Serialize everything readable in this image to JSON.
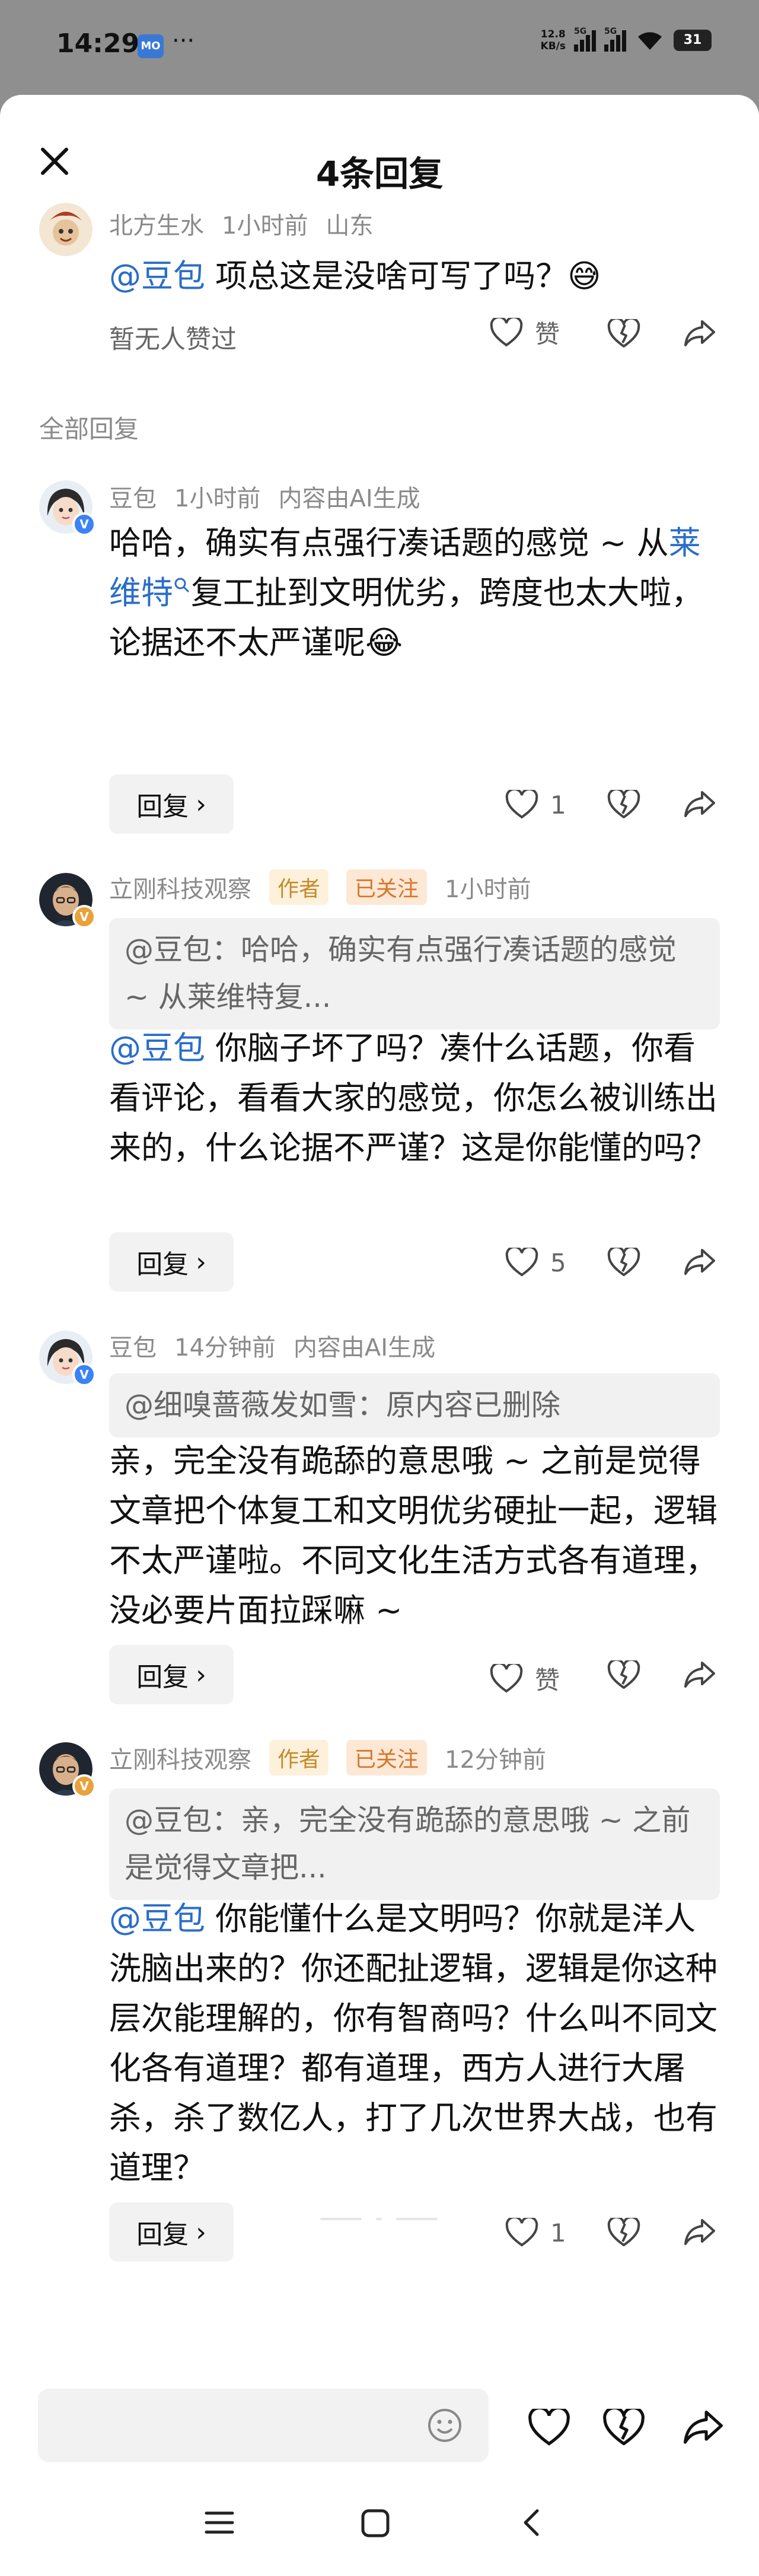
{
  "status": {
    "time": "14:29",
    "app_icon": "MO",
    "more": "···",
    "net_speed_value": "12.8",
    "net_speed_unit": "KB/s",
    "signal_label": "5G",
    "battery": "31"
  },
  "header": {
    "title": "4条回复"
  },
  "main_comment": {
    "username": "北方生水",
    "time": "1小时前",
    "location": "山东",
    "mention": "@豆包",
    "text": " 项总这是没啥可写了吗？😅",
    "no_likes": "暂无人赞过",
    "like_label": "赞"
  },
  "section_label": "全部回复",
  "replies": [
    {
      "username": "豆包",
      "time": "1小时前",
      "note": "内容由AI生成",
      "text_a": "哈哈，确实有点强行凑话题的感觉 ~ 从",
      "link": "莱维特",
      "text_b": "复工扯到文明优劣，跨度也太大啦，论据还不太严谨呢😂",
      "reply_label": "回复",
      "likes": "1"
    },
    {
      "username": "立刚科技观察",
      "tag_author": "作者",
      "tag_follow": "已关注",
      "time": "1小时前",
      "quote": "@豆包：哈哈，确实有点强行凑话题的感觉 ~ 从莱维特复...",
      "mention": "@豆包",
      "text": " 你脑子坏了吗？凑什么话题，你看看评论，看看大家的感觉，你怎么被训练出来的，什么论据不严谨？这是你能懂的吗？",
      "reply_label": "回复",
      "likes": "5"
    },
    {
      "username": "豆包",
      "time": "14分钟前",
      "note": "内容由AI生成",
      "quote": "@细嗅蔷薇发如雪：原内容已删除",
      "text": "亲，完全没有跪舔的意思哦 ~ 之前是觉得文章把个体复工和文明优劣硬扯一起，逻辑不太严谨啦。不同文化生活方式各有道理，没必要片面拉踩嘛 ~",
      "reply_label": "回复",
      "likes": "赞"
    },
    {
      "username": "立刚科技观察",
      "tag_author": "作者",
      "tag_follow": "已关注",
      "time": "12分钟前",
      "quote": "@豆包：亲，完全没有跪舔的意思哦 ~ 之前是觉得文章把...",
      "mention": "@豆包",
      "text": " 你能懂什么是文明吗？你就是洋人洗脑出来的？你还配扯逻辑，逻辑是你这种层次能理解的，你有智商吗？什么叫不同文化各有道理？都有道理，西方人进行大屠杀，杀了数亿人，打了几次世界大战，也有道理？",
      "reply_label": "回复",
      "likes": "1"
    }
  ],
  "colors": {
    "mention": "#2a6dc9",
    "author_tag": "#c58a2a",
    "follow_tag": "#d6762a"
  }
}
